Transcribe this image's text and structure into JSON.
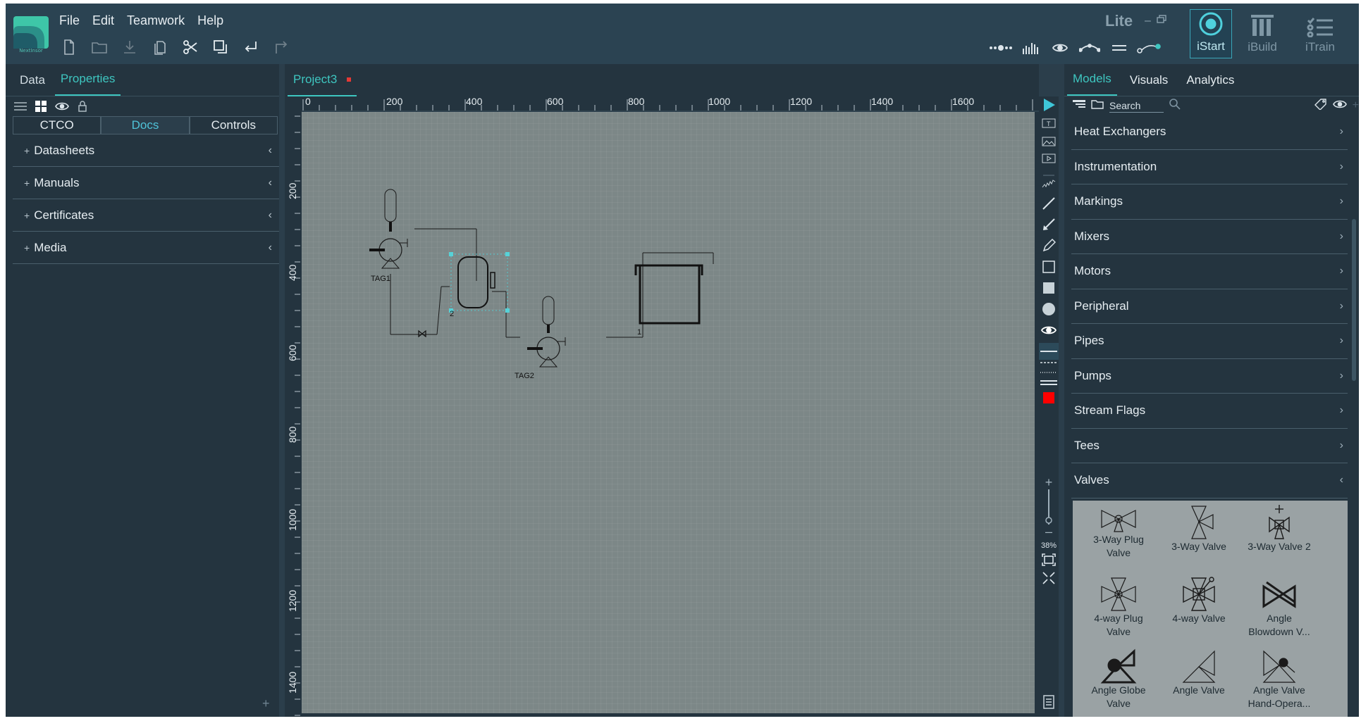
{
  "app": {
    "brand_caption": "NextInsor",
    "edition": "Lite",
    "menu": [
      "File",
      "Edit",
      "Teamwork",
      "Help"
    ],
    "toolbar_icons": [
      "new-file-icon",
      "open-folder-icon",
      "download-icon",
      "copy-icon",
      "scissors-icon",
      "duplicate-icon",
      "return-icon",
      "redirect-icon"
    ],
    "view_icons": [
      "connection-points-icon",
      "bar-chart-icon",
      "eye-icon",
      "link-curve-icon",
      "parallel-lines-icon",
      "connect-icon"
    ],
    "modes": [
      {
        "label": "iStart",
        "active": true
      },
      {
        "label": "iBuild",
        "active": false
      },
      {
        "label": "iTrain",
        "active": false
      }
    ]
  },
  "left_panel": {
    "tabs": [
      {
        "label": "Data",
        "active": false
      },
      {
        "label": "Properties",
        "active": true
      }
    ],
    "subtabs": [
      {
        "label": "CTCO",
        "active": false
      },
      {
        "label": "Docs",
        "active": true
      },
      {
        "label": "Controls",
        "active": false
      }
    ],
    "sections": [
      "Datasheets",
      "Manuals",
      "Certificates",
      "Media"
    ]
  },
  "document": {
    "tab_label": "Project3",
    "unsaved": true,
    "ruler_h": [
      "0",
      "200",
      "400",
      "600",
      "800",
      "1000",
      "1200",
      "1400",
      "1600"
    ],
    "ruler_v": [
      "200",
      "400",
      "600",
      "800",
      "1000",
      "1200",
      "1400"
    ],
    "labels": {
      "tag1": "TAG1",
      "tag2": "TAG2",
      "node2": "2",
      "node1": "1"
    }
  },
  "tools": {
    "zoom_level": "38%",
    "active_color": "#ff0000"
  },
  "right_panel": {
    "tabs": [
      {
        "label": "Models",
        "active": true
      },
      {
        "label": "Visuals",
        "active": false
      },
      {
        "label": "Analytics",
        "active": false
      }
    ],
    "search_placeholder": "Search",
    "categories": [
      {
        "label": "Heat Exchangers",
        "expanded": false
      },
      {
        "label": "Instrumentation",
        "expanded": false
      },
      {
        "label": "Markings",
        "expanded": false
      },
      {
        "label": "Mixers",
        "expanded": false
      },
      {
        "label": "Motors",
        "expanded": false
      },
      {
        "label": "Peripheral",
        "expanded": false
      },
      {
        "label": "Pipes",
        "expanded": false
      },
      {
        "label": "Pumps",
        "expanded": false
      },
      {
        "label": "Stream Flags",
        "expanded": false
      },
      {
        "label": "Tees",
        "expanded": false
      },
      {
        "label": "Valves",
        "expanded": true
      }
    ],
    "valves": [
      {
        "line1": "3-Way Plug",
        "line2": "Valve",
        "icon": "three-way-plug-valve-icon"
      },
      {
        "line1": "3-Way Valve",
        "line2": "",
        "icon": "three-way-valve-icon"
      },
      {
        "line1": "3-Way Valve 2",
        "line2": "",
        "icon": "three-way-valve-2-icon"
      },
      {
        "line1": "4-way Plug",
        "line2": "Valve",
        "icon": "four-way-plug-valve-icon"
      },
      {
        "line1": "4-way Valve",
        "line2": "",
        "icon": "four-way-valve-icon"
      },
      {
        "line1": "Angle",
        "line2": "Blowdown V...",
        "icon": "angle-blowdown-valve-icon"
      },
      {
        "line1": "Angle Globe",
        "line2": "Valve",
        "icon": "angle-globe-valve-icon"
      },
      {
        "line1": "Angle Valve",
        "line2": "",
        "icon": "angle-valve-icon"
      },
      {
        "line1": "Angle Valve",
        "line2": "Hand-Opera...",
        "icon": "angle-valve-hand-operated-icon"
      }
    ]
  }
}
